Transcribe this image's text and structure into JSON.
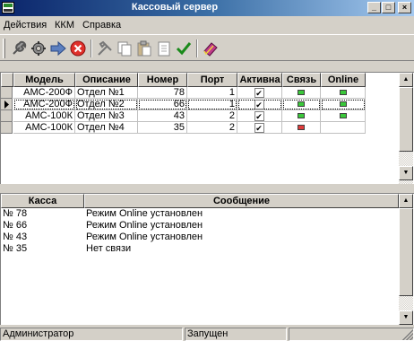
{
  "window": {
    "title": "Кассовый сервер"
  },
  "title_buttons": {
    "minimize": "_",
    "maximize": "□",
    "close": "×"
  },
  "menu": {
    "items": [
      "Действия",
      "ККМ",
      "Справка"
    ]
  },
  "toolbar": {
    "buttons": [
      "wrench-icon",
      "gear-icon",
      "arrow-right-icon",
      "stop-icon",
      "tools-icon",
      "copy-icon",
      "paste-icon",
      "document-icon",
      "check-icon",
      "book-icon"
    ]
  },
  "devices": {
    "columns": [
      "Модель",
      "Описание",
      "Номер",
      "Порт",
      "Активна",
      "Связь",
      "Online"
    ],
    "rows": [
      {
        "model": "АМС-200Ф",
        "description": "Отдел №1",
        "number": "78",
        "port": "1",
        "active": true,
        "link": "green",
        "online": "green"
      },
      {
        "model": "АМС-200Ф",
        "description": "Отдел №2",
        "number": "66",
        "port": "1",
        "active": true,
        "link": "green",
        "online": "green"
      },
      {
        "model": "АМС-100К",
        "description": "Отдел №3",
        "number": "43",
        "port": "2",
        "active": true,
        "link": "green",
        "online": "green"
      },
      {
        "model": "АМС-100К",
        "description": "Отдел №4",
        "number": "35",
        "port": "2",
        "active": true,
        "link": "red",
        "online": ""
      }
    ],
    "selected_row": 1
  },
  "messages": {
    "columns": [
      "Касса",
      "Сообщение"
    ],
    "rows": [
      {
        "register": "№ 78",
        "message": "Режим Online установлен"
      },
      {
        "register": "№ 66",
        "message": "Режим Online установлен"
      },
      {
        "register": "№ 43",
        "message": "Режим Online установлен"
      },
      {
        "register": "№ 35",
        "message": "Нет связи"
      }
    ]
  },
  "status": {
    "user": "Администратор",
    "state": "Запущен"
  },
  "colors": {
    "title_start": "#0a246a",
    "title_end": "#a6caf0",
    "led_green": "#3ac83a",
    "led_red": "#e03c3c",
    "face": "#d4d0c8"
  }
}
